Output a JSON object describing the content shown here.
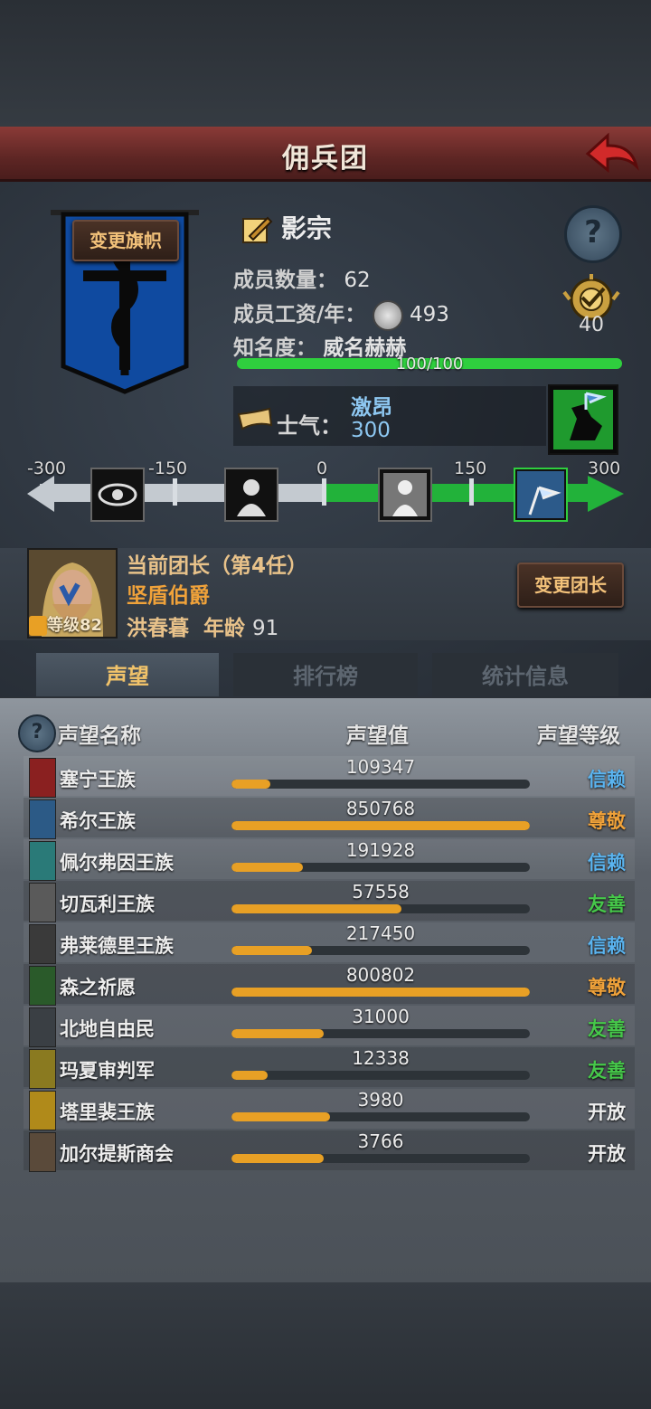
{
  "header": {
    "title": "佣兵团"
  },
  "guild": {
    "name": "影宗",
    "members_label": "成员数量：",
    "members": "62",
    "wage_label": "成员工资/年：",
    "wage": "493",
    "fame_label": "知名度：",
    "fame_title": "威名赫赫",
    "fame_progress_text": "100/100",
    "fame_progress": 1.0,
    "rank_number": "40",
    "change_flag_label": "变更旗帜"
  },
  "morale": {
    "label": "士气：",
    "state": "激昂",
    "value": "300",
    "scale_labels": [
      "-300",
      "-150",
      "0",
      "150",
      "300"
    ]
  },
  "leader": {
    "current_label": "当前团长（第4任）",
    "title": "坚盾伯爵",
    "name": "洪春暮",
    "age_label": "年龄",
    "age": "91",
    "level": "等级82",
    "change_leader_label": "变更团长"
  },
  "tabs": [
    "声望",
    "排行榜",
    "统计信息"
  ],
  "reputation": {
    "headers": {
      "name": "声望名称",
      "value": "声望值",
      "level": "声望等级"
    },
    "rows": [
      {
        "name": "塞宁王族",
        "value": "109347",
        "fill": 0.13,
        "level": "信赖",
        "level_color": "#5ab4f0",
        "icon_color": "#8a2020"
      },
      {
        "name": "希尔王族",
        "value": "850768",
        "fill": 1.0,
        "level": "尊敬",
        "level_color": "#f0a23a",
        "icon_color": "#2c5a86"
      },
      {
        "name": "佩尔弗因王族",
        "value": "191928",
        "fill": 0.24,
        "level": "信赖",
        "level_color": "#5ab4f0",
        "icon_color": "#2a7a78"
      },
      {
        "name": "切瓦利王族",
        "value": "57558",
        "fill": 0.57,
        "level": "友善",
        "level_color": "#46c84a",
        "icon_color": "#5a5a5a"
      },
      {
        "name": "弗莱德里王族",
        "value": "217450",
        "fill": 0.27,
        "level": "信赖",
        "level_color": "#5ab4f0",
        "icon_color": "#3a3a3a"
      },
      {
        "name": "森之祈愿",
        "value": "800802",
        "fill": 1.0,
        "level": "尊敬",
        "level_color": "#f0a23a",
        "icon_color": "#2a5a2a"
      },
      {
        "name": "北地自由民",
        "value": "31000",
        "fill": 0.31,
        "level": "友善",
        "level_color": "#46c84a",
        "icon_color": "#3a3f44"
      },
      {
        "name": "玛夏审判军",
        "value": "12338",
        "fill": 0.12,
        "level": "友善",
        "level_color": "#46c84a",
        "icon_color": "#8a7a20"
      },
      {
        "name": "塔里裴王族",
        "value": "3980",
        "fill": 0.33,
        "level": "开放",
        "level_color": "#eeeeee",
        "icon_color": "#b08a1a"
      },
      {
        "name": "加尔提斯商会",
        "value": "3766",
        "fill": 0.31,
        "level": "开放",
        "level_color": "#eeeeee",
        "icon_color": "#5a4a3a"
      }
    ]
  }
}
